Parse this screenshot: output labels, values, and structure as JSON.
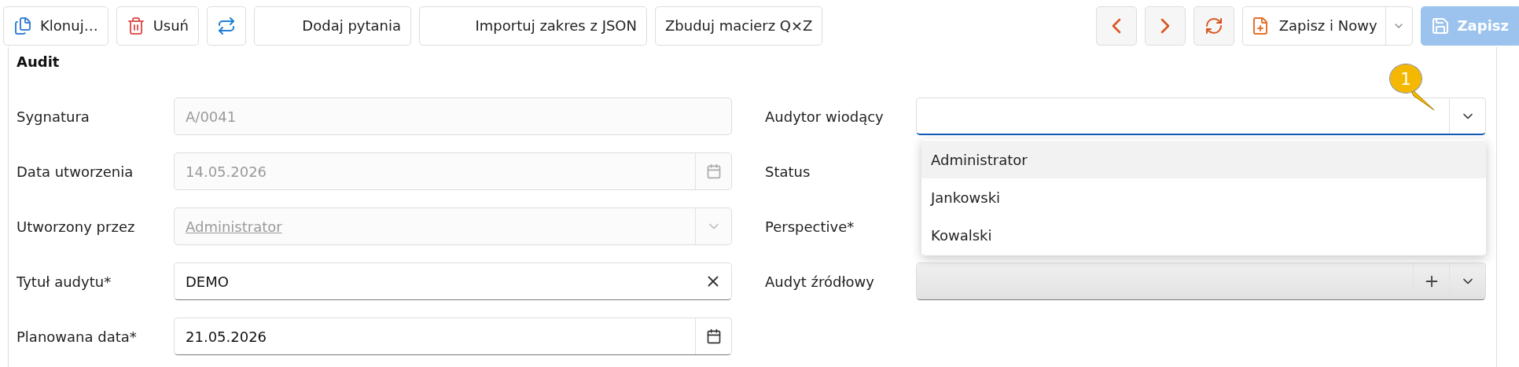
{
  "toolbar": {
    "left": [
      {
        "kind": "clone",
        "label": "Klonuj…"
      },
      {
        "kind": "delete",
        "label": "Usuń"
      },
      {
        "kind": "transfer"
      },
      {
        "kind": "text",
        "label": "Dodaj pytania"
      },
      {
        "kind": "text",
        "label": "Importuj zakres z JSON"
      },
      {
        "kind": "text",
        "label": "Zbuduj macierz Q×Z"
      }
    ],
    "right": [
      {
        "kind": "prev"
      },
      {
        "kind": "next"
      },
      {
        "kind": "refresh"
      },
      {
        "kind": "split",
        "label": "Zapisz i Nowy"
      },
      {
        "kind": "primary",
        "label": "Zapisz",
        "disabled": true
      }
    ]
  },
  "section": {
    "title": "Audit"
  },
  "left_fields": [
    {
      "label": "Sygnatura",
      "value": "A/0041",
      "kind": "text",
      "disabled": true
    },
    {
      "label": "Data utworzenia",
      "value": "14.05.2026",
      "kind": "date",
      "disabled": true
    },
    {
      "label": "Utworzony przez",
      "value": "Administrator",
      "kind": "link-select",
      "disabled": true
    },
    {
      "label": "Tytuł audytu*",
      "value": "DEMO",
      "kind": "clear",
      "disabled": false
    },
    {
      "label": "Planowana data*",
      "value": "21.05.2026",
      "kind": "date",
      "disabled": false
    }
  ],
  "right_fields": [
    {
      "label": "Audytor wiodący",
      "kind": "select",
      "focused": true
    },
    {
      "label": "Status"
    },
    {
      "label": "Perspective*"
    },
    {
      "label": "Audyt źródłowy",
      "kind": "lookup",
      "focused": false
    }
  ],
  "dropdown": {
    "items": [
      {
        "label": "Administrator",
        "selected": true
      },
      {
        "label": "Jankowski",
        "selected": false
      },
      {
        "label": "Kowalski",
        "selected": false
      }
    ]
  },
  "callout": {
    "label": "1"
  }
}
